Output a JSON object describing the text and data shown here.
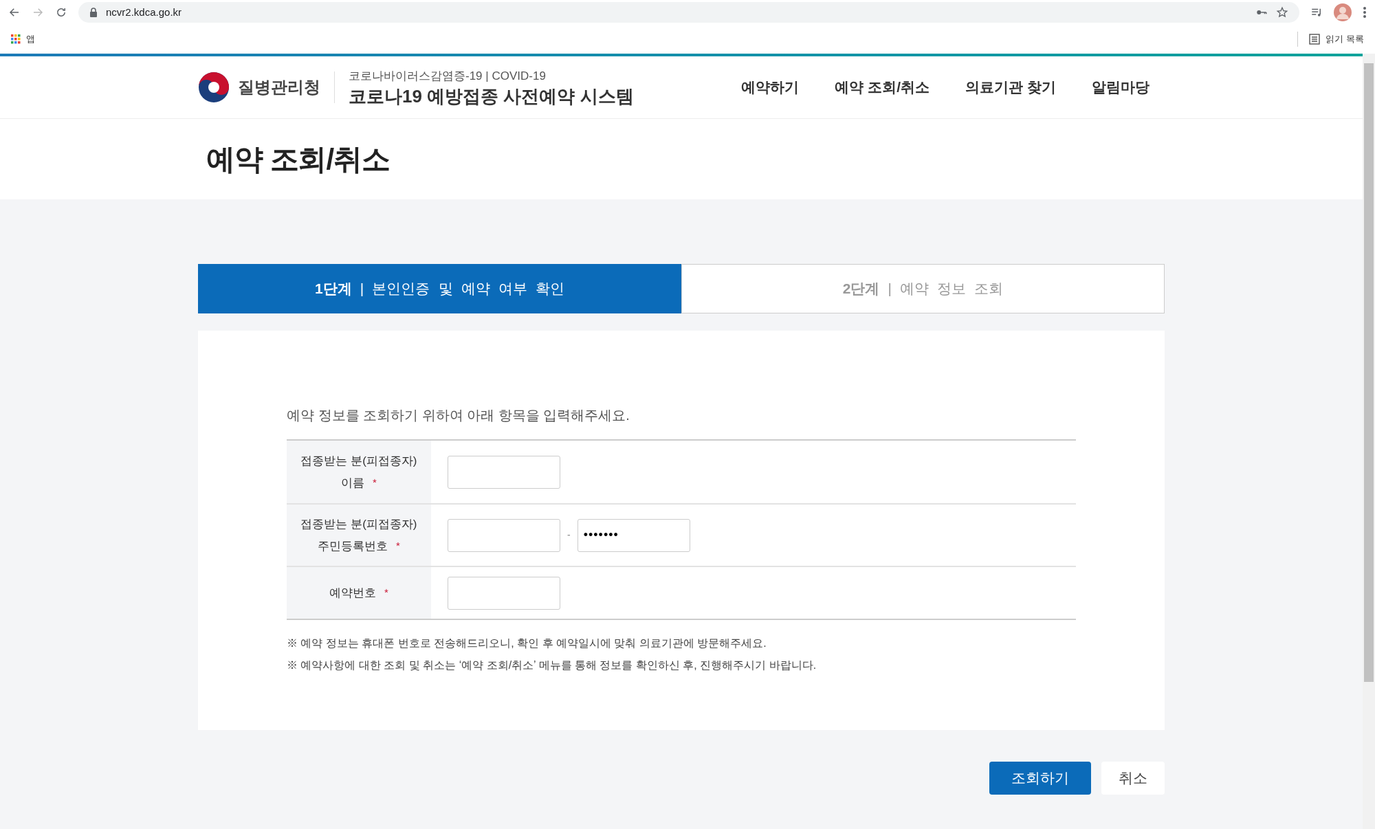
{
  "browser": {
    "url": "ncvr2.kdca.go.kr",
    "bookmarks": [
      {
        "label": "앱"
      }
    ],
    "reading_list": "읽기 목록"
  },
  "header": {
    "agency": "질병관리청",
    "subtitle": "코로나바이러스감염증-19 | COVID-19",
    "system_title": "코로나19 예방접종 사전예약 시스템",
    "nav": [
      {
        "label": "예약하기"
      },
      {
        "label": "예약 조회/취소"
      },
      {
        "label": "의료기관 찾기"
      },
      {
        "label": "알림마당"
      }
    ]
  },
  "page_title": "예약 조회/취소",
  "steps": [
    {
      "label": "**1단계** | 본인인증 및 예약 여부 확인",
      "selected": true
    },
    {
      "label": "**2단계** | 예약 정보 조회",
      "selected": false
    }
  ],
  "form": {
    "required_mark": "*",
    "intro": "예약 정보를 조회하기 위하여 아래 항목을 입력해주세요.",
    "fields": [
      {
        "kind": "text",
        "label_lines": [
          "접종받는 분(피접종자)",
          "이름"
        ],
        "required": true
      },
      {
        "kind": "split",
        "label_lines": [
          "접종받는 분(피접종자)",
          "주민등록번호"
        ],
        "required": true,
        "separator": "-",
        "masked_value": "•••••••"
      },
      {
        "kind": "text",
        "label_lines": [
          "예약번호"
        ],
        "required": true
      }
    ],
    "notes": [
      "※ 예약 정보는 휴대폰 번호로 전송해드리오니, 확인 후 예약일시에 맞춰 의료기관에 방문해주세요.",
      "※ 예약사항에 대한 조회 및 취소는 ‘예약 조회/취소’ 메뉴를 통해 정보를 확인하신 후, 진행해주시기 바랍니다."
    ]
  },
  "buttons": [
    {
      "label": "조회하기",
      "kind": "primary"
    },
    {
      "label": "취소",
      "kind": "secondary"
    }
  ]
}
